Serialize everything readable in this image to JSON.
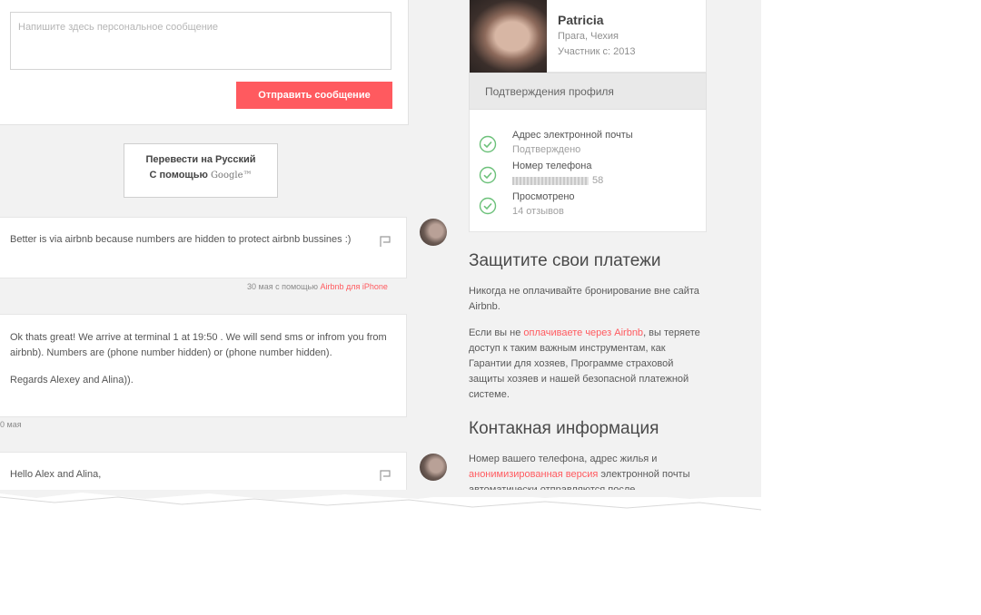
{
  "composer": {
    "placeholder": "Напишите здесь персональное сообщение",
    "send_label": "Отправить сообщение"
  },
  "translate": {
    "line1": "Перевести на Русский",
    "line2": "С помощью",
    "brand": "Google™"
  },
  "messages": [
    {
      "text": "Better is via airbnb because numbers are hidden to protect airbnb bussines :)",
      "meta_prefix": "30 мая с помощью ",
      "meta_link": "Airbnb для iPhone"
    },
    {
      "p1": "Ok thats great! We arrive at terminal 1 at 19:50 . We will send sms or infrom you from airbnb). Numbers are (phone number hidden) or (phone number hidden).",
      "p2": "Regards Alexey and Alina)).",
      "meta": "0 мая"
    },
    {
      "text": "Hello Alex and Alina,"
    }
  ],
  "profile": {
    "name": "Patricia",
    "location": "Прага, Чехия",
    "member_since": "Участник с: 2013"
  },
  "verifications": {
    "title": "Подтверждения профиля",
    "items": [
      {
        "label": "Адрес электронной почты",
        "sub": "Подтверждено"
      },
      {
        "label": "Номер телефона",
        "sub": "58"
      },
      {
        "label": "Просмотрено",
        "sub": "14 отзывов"
      }
    ]
  },
  "protect": {
    "title": "Защитите свои платежи",
    "p1": "Никогда не оплачивайте бронирование вне сайта Airbnb.",
    "p2_before": "Если вы не ",
    "p2_link": "оплачиваете через Airbnb",
    "p2_after": ", вы теряете доступ к таким важным инструментам, как Гарантии для хозяев, Программе страховой защиты хозяев и нашей безопасной платежной системе."
  },
  "contact": {
    "title": "Контакная информация",
    "p_before": "Номер вашего телефона, адрес жилья и ",
    "p_link": "анонимизированная версия",
    "p_after": " электронной почты автоматически отправляются после"
  },
  "colors": {
    "accent": "#ff5a5f",
    "check": "#6cc17a",
    "page_bg": "#f2f2f2"
  }
}
